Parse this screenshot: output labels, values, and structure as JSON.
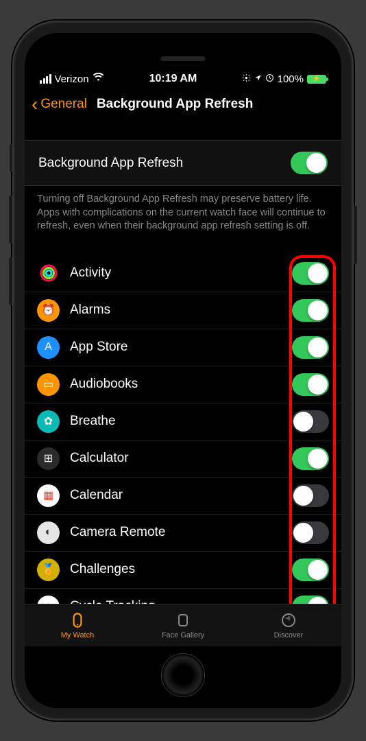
{
  "status": {
    "carrier": "Verizon",
    "time": "10:19 AM",
    "battery_pct": "100%",
    "icons": "⊙ ➤ ⏰"
  },
  "nav": {
    "back_label": "General",
    "title": "Background App Refresh"
  },
  "master": {
    "label": "Background App Refresh",
    "enabled": true
  },
  "description": "Turning off Background App Refresh may preserve battery life. Apps with complications on the current watch face will continue to refresh, even when their background app refresh setting is off.",
  "apps": [
    {
      "name": "Activity",
      "enabled": true,
      "icon_bg": "#000",
      "icon_glyph": "◎",
      "icon_color": "conic"
    },
    {
      "name": "Alarms",
      "enabled": true,
      "icon_bg": "#ff9500",
      "icon_glyph": "⏰"
    },
    {
      "name": "App Store",
      "enabled": true,
      "icon_bg": "#1e90ff",
      "icon_glyph": "A"
    },
    {
      "name": "Audiobooks",
      "enabled": true,
      "icon_bg": "#ff9500",
      "icon_glyph": "▭"
    },
    {
      "name": "Breathe",
      "enabled": false,
      "icon_bg": "#0abab5",
      "icon_glyph": "✿"
    },
    {
      "name": "Calculator",
      "enabled": true,
      "icon_bg": "#2b2b2b",
      "icon_glyph": "⊞"
    },
    {
      "name": "Calendar",
      "enabled": false,
      "icon_bg": "#fff",
      "icon_glyph": "▦",
      "icon_fg": "#ff3b30"
    },
    {
      "name": "Camera Remote",
      "enabled": false,
      "icon_bg": "#e5e5e5",
      "icon_glyph": "◐",
      "icon_fg": "#333"
    },
    {
      "name": "Challenges",
      "enabled": true,
      "icon_bg": "#d4b000",
      "icon_glyph": "🏅"
    },
    {
      "name": "Cycle Tracking",
      "enabled": true,
      "icon_bg": "#fff",
      "icon_glyph": "◌",
      "icon_fg": "#ff2d55"
    }
  ],
  "tabs": [
    {
      "label": "My Watch",
      "active": true
    },
    {
      "label": "Face Gallery",
      "active": false
    },
    {
      "label": "Discover",
      "active": false
    }
  ]
}
